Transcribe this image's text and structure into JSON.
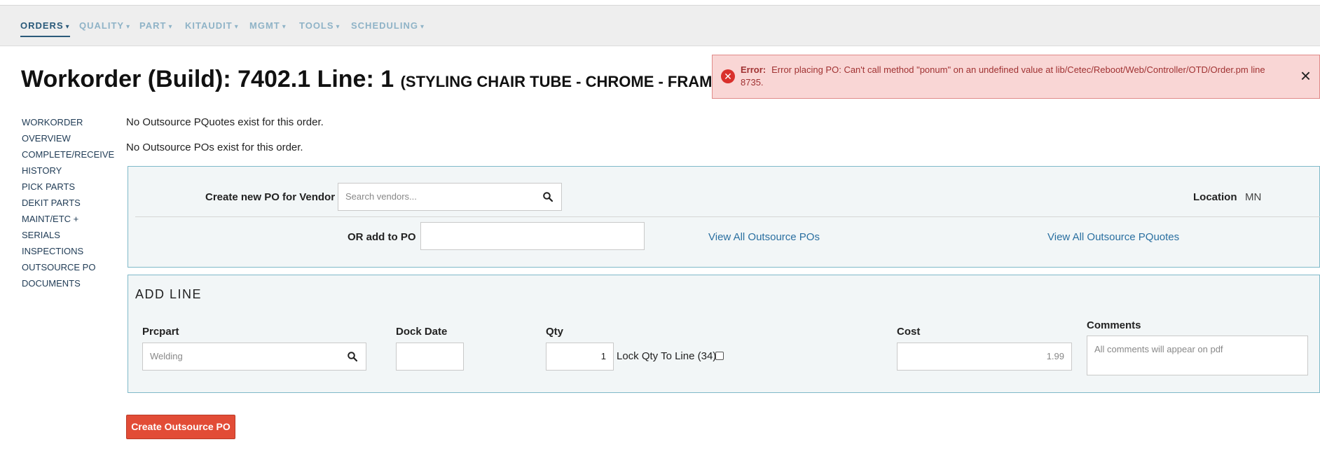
{
  "nav": {
    "items": [
      {
        "label": "ORDERS"
      },
      {
        "label": "QUALITY"
      },
      {
        "label": "PART"
      },
      {
        "label": "KITAUDIT"
      },
      {
        "label": "MGMT"
      },
      {
        "label": "TOOLS"
      },
      {
        "label": "SCHEDULING"
      }
    ],
    "caret": "▾"
  },
  "header": {
    "title": "Workorder (Build): 7402.1 Line: 1",
    "subtitle": "(STYLING CHAIR TUBE - CHROME - FRAME)"
  },
  "error": {
    "label": "Error:",
    "message": "Error placing PO: Can't call method \"ponum\" on an undefined value at lib/Cetec/Reboot/Web/Controller/OTD/Order.pm line 8735.",
    "close": "×",
    "icon": "x-circle-icon"
  },
  "sidebar": {
    "items": [
      {
        "label": "WORKORDER"
      },
      {
        "label": "OVERVIEW"
      },
      {
        "label": "COMPLETE/RECEIVE"
      },
      {
        "label": "HISTORY"
      },
      {
        "label": "PICK PARTS"
      },
      {
        "label": "DEKIT PARTS"
      },
      {
        "label": "MAINT/ETC +"
      },
      {
        "label": "SERIALS"
      },
      {
        "label": "INSPECTIONS"
      },
      {
        "label": "OUTSOURCE PO"
      },
      {
        "label": "DOCUMENTS"
      }
    ]
  },
  "messages": {
    "no_pquotes": "No Outsource PQuotes exist for this order.",
    "no_pos": "No Outsource POs exist for this order."
  },
  "po_panel": {
    "vendor_label": "Create new PO for Vendor",
    "vendor_placeholder": "Search vendors...",
    "location_label": "Location",
    "location_value": "MN",
    "add_to_po_label": "OR add to PO",
    "add_to_po_value": "",
    "view_pos_link": "View All Outsource POs",
    "view_pquotes_link": "View All Outsource PQuotes"
  },
  "add_line": {
    "title": "ADD LINE",
    "prcpart_label": "Prcpart",
    "prcpart_placeholder": "Welding",
    "dock_date_label": "Dock Date",
    "dock_date_value": "",
    "qty_label": "Qty",
    "qty_value": "1",
    "lock_qty_label": "Lock Qty To Line (34)",
    "lock_qty_checked": false,
    "cost_label": "Cost",
    "cost_value": "1.99",
    "comments_label": "Comments",
    "comments_placeholder": "All comments will appear on pdf"
  },
  "actions": {
    "create_button": "Create Outsource PO"
  },
  "colors": {
    "accent": "#2a5a7a",
    "nav_inactive": "#8fb3c7",
    "error_bg": "#f9d6d5",
    "error_text": "#a03232",
    "button": "#e24c36",
    "link": "#2a6fa0",
    "panel_border": "#7fb9c9"
  }
}
